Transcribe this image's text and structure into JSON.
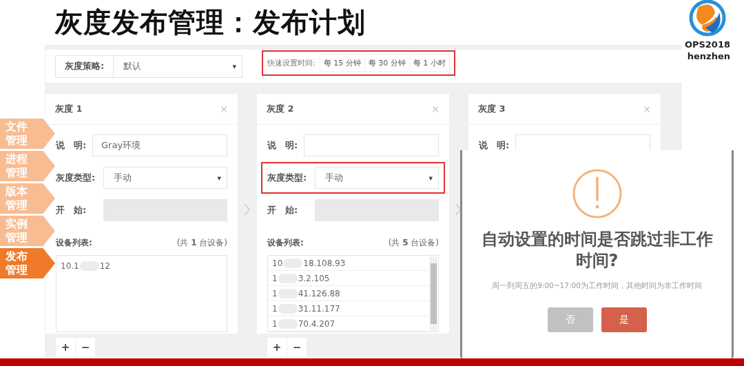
{
  "slide_title": "灰度发布管理：发布计划",
  "logo": {
    "lines": [
      "OPS2018",
      "henzhen"
    ]
  },
  "sidebar": {
    "items": [
      {
        "lines": [
          "文件",
          "管理"
        ],
        "selected": false
      },
      {
        "lines": [
          "进程",
          "管理"
        ],
        "selected": false
      },
      {
        "lines": [
          "版本",
          "管理"
        ],
        "selected": false
      },
      {
        "lines": [
          "实例",
          "管理"
        ],
        "selected": false
      },
      {
        "lines": [
          "发布",
          "管理"
        ],
        "selected": true
      }
    ]
  },
  "toolbar": {
    "strategy": {
      "label": "灰度策略:",
      "value": "默认",
      "caret": "▾"
    },
    "quick_time": {
      "label": "快速设置时间:",
      "highlighted": true,
      "options": [
        "每 15 分钟",
        "每 30 分钟",
        "每 1 小时"
      ]
    }
  },
  "cards": [
    {
      "title": "灰度 1",
      "close": "×",
      "description": {
        "label": "说　明:",
        "value": "Gray环境"
      },
      "type": {
        "label": "灰度类型:",
        "value": "手动",
        "caret": "▾",
        "highlighted": false
      },
      "start": {
        "label": "开　始:"
      },
      "devices": {
        "label": "设备列表:",
        "count": "(共 **1** 台设备)",
        "scrollbar": false,
        "items": [
          {
            "start": "10.1",
            "end": "12"
          }
        ]
      },
      "controls": [
        "+",
        "−"
      ]
    },
    {
      "title": "灰度 2",
      "close": "×",
      "description": {
        "label": "说　明:"
      },
      "type": {
        "label": "灰度类型:",
        "value": "手动",
        "caret": "▾",
        "highlighted": true
      },
      "start": {
        "label": "开　始:"
      },
      "devices": {
        "label": "设备列表:",
        "count": "(共 **5** 台设备)",
        "scrollbar": true,
        "items": [
          {
            "start": "10",
            "end": "18.108.93"
          },
          {
            "start": "1",
            "end": "3.2.105"
          },
          {
            "start": "1",
            "end": "41.126.88"
          },
          {
            "start": "1",
            "end": "31.11.177"
          },
          {
            "start": "1",
            "end": "70.4.207"
          }
        ]
      },
      "controls": [
        "+",
        "−"
      ]
    },
    {
      "title": "灰度 3",
      "close": "×",
      "description": {
        "label": "说　明:"
      }
    }
  ],
  "dialog": {
    "title": "自动设置的时间是否跳过非工作时间?",
    "message": "周一到周五的9:00~17:00为工作时间，其他时间为非工作时间",
    "buttons": [
      {
        "label": "否",
        "kind": "cancel"
      },
      {
        "label": "是",
        "kind": "confirm"
      }
    ]
  }
}
